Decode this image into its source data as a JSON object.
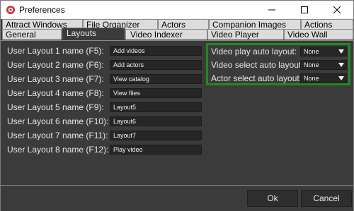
{
  "window": {
    "title": "Preferences",
    "icons": {
      "app": "app-icon",
      "minimize": "minimize-icon",
      "maximize": "maximize-icon",
      "close": "close-icon"
    }
  },
  "tabs": {
    "row1": [
      "Attract Windows",
      "File Organizer",
      "Actors",
      "Companion Images",
      "Actions"
    ],
    "row2": [
      "General",
      "Layouts",
      "Video Indexer",
      "Video Player",
      "Video Wall"
    ],
    "active": "Layouts"
  },
  "layouts": [
    {
      "label": "User Layout 1 name (F5):",
      "value": "Add videos"
    },
    {
      "label": "User Layout 2 name (F6):",
      "value": "Add actors"
    },
    {
      "label": "User Layout 3 name (F7):",
      "value": "View catalog"
    },
    {
      "label": "User Layout 4 name (F8):",
      "value": "View files"
    },
    {
      "label": "User Layout 5 name (F9):",
      "value": "Layout5"
    },
    {
      "label": "User Layout 6 name (F10):",
      "value": "Layout6"
    },
    {
      "label": "User Layout 7 name (F11):",
      "value": "Layout7"
    },
    {
      "label": "User Layout 8 name (F12):",
      "value": "Play video"
    }
  ],
  "auto_layouts": [
    {
      "label": "Video play auto layout:",
      "value": "None"
    },
    {
      "label": "Video select auto layout:",
      "value": "None"
    },
    {
      "label": "Actor select auto layout:",
      "value": "None"
    }
  ],
  "buttons": {
    "ok": "Ok",
    "cancel": "Cancel"
  },
  "colors": {
    "highlight_border": "#1f8a1f",
    "panel_bg": "#3b3b3b"
  }
}
